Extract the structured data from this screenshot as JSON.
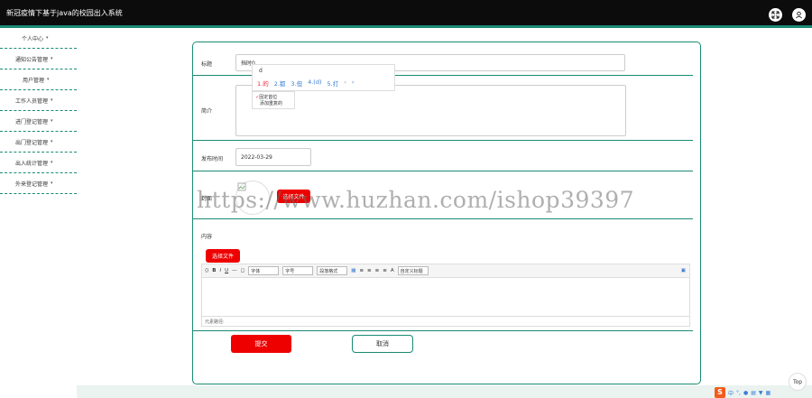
{
  "app": {
    "title": "新冠疫情下基于java的校园出入系统"
  },
  "header_icons": [
    {
      "name": "fullscreen-icon"
    },
    {
      "name": "user-icon"
    }
  ],
  "sidebar": {
    "items": [
      {
        "label": "个人中心"
      },
      {
        "label": "通知公告管理"
      },
      {
        "label": "用户管理"
      },
      {
        "label": "工作人员管理"
      },
      {
        "label": "进门登记管理"
      },
      {
        "label": "出门登记管理"
      },
      {
        "label": "出入统计管理"
      },
      {
        "label": "外来登记管理"
      }
    ]
  },
  "form": {
    "title_label": "标题",
    "title_value": "挡时0",
    "summary_label": "简介",
    "publish_time_label": "发布时间",
    "publish_time_value": "2022-03-29",
    "cover_label": "封面",
    "upload_button": "选择文件",
    "content_label": "内容",
    "content_upload_button": "选择文件",
    "submit_label": "提交",
    "cancel_label": "取消"
  },
  "ime": {
    "input": "d",
    "candidates": [
      "1.的",
      "2.都",
      "3.但",
      "4.(d)",
      "5.打"
    ],
    "menu": [
      "固定首位",
      "添加重复的"
    ]
  },
  "editor": {
    "toolbar": {
      "font_family": "字体",
      "font_size": "字号",
      "paragraph": "段落格式",
      "custom_title": "自定义标题"
    },
    "path_label": "元素路径:"
  },
  "watermark": "https://www.huzhan.com/ishop39397",
  "top_button": "Top",
  "colors": {
    "accent": "#1a8a74",
    "danger": "#ee0000",
    "header_bg": "#0c0c0c"
  }
}
